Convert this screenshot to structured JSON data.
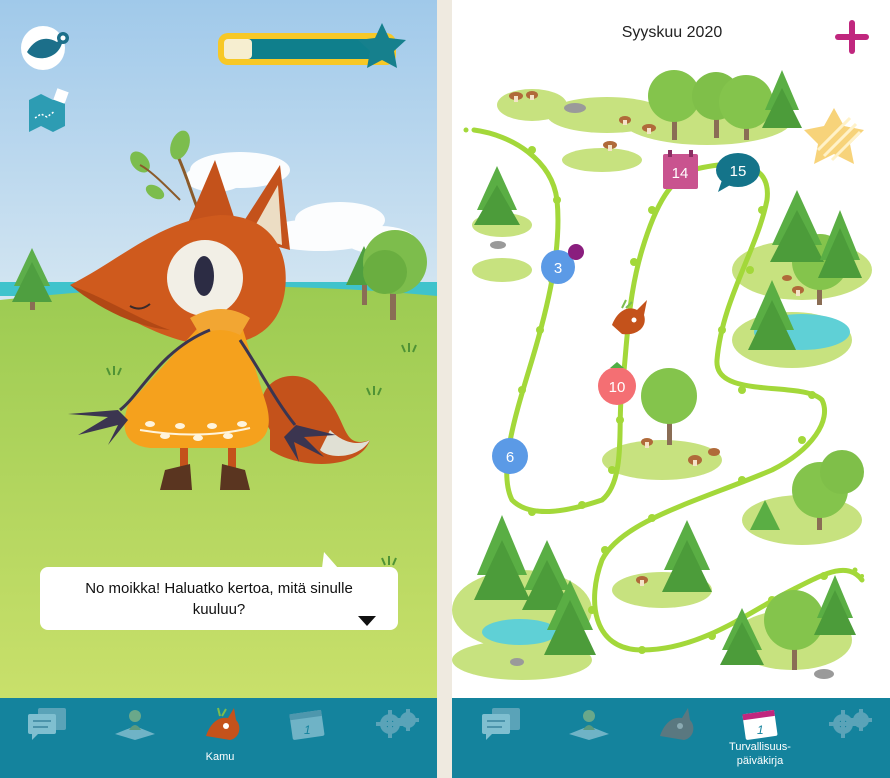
{
  "left": {
    "speech": {
      "text": "No moikka! Haluatko kertoa, mitä sinulle kuuluu?"
    },
    "tabs": [
      {
        "icon": "chat-icon"
      },
      {
        "icon": "meditation-icon"
      },
      {
        "icon": "fox-icon",
        "label": "Kamu",
        "active": true
      },
      {
        "icon": "calendar-icon",
        "date": "1"
      },
      {
        "icon": "gears-icon"
      }
    ]
  },
  "right": {
    "month": "Syyskuu 2020",
    "path_days": [
      {
        "label": "3",
        "color": "#5b9ae6"
      },
      {
        "label": "6",
        "color": "#5b9ae6"
      },
      {
        "label": "10",
        "color": "#f46f73"
      },
      {
        "label": "14",
        "color": "#c9538f"
      },
      {
        "label": "15",
        "color": "#14748a"
      }
    ],
    "tabs": [
      {
        "icon": "chat-icon"
      },
      {
        "icon": "meditation-icon"
      },
      {
        "icon": "fox-icon"
      },
      {
        "icon": "calendar-icon",
        "date": "1",
        "label": "Turvallisuus-\npäiväkirja",
        "active": true
      },
      {
        "icon": "gears-icon"
      }
    ]
  },
  "colors": {
    "tabbar": "#14839d",
    "sky_top": "#a4cde9",
    "grass": "#a9d25a",
    "fox": "#cf5a1d",
    "dress": "#f6a21e",
    "accent_plus": "#c0277e"
  }
}
